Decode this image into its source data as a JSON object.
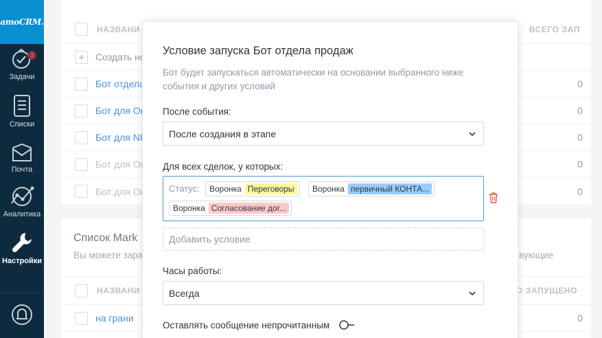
{
  "sidebar": {
    "logo": "amoCRM.",
    "badge": "3",
    "items": [
      {
        "label": "Задачи",
        "icon": "tasks-icon"
      },
      {
        "label": "Списки",
        "icon": "lists-icon"
      },
      {
        "label": "Почта",
        "icon": "mail-icon"
      },
      {
        "label": "Аналитика",
        "icon": "analytics-icon"
      },
      {
        "label": "Настройки",
        "icon": "settings-icon",
        "active": true
      }
    ],
    "bottom_icon": "bell-icon"
  },
  "background": {
    "top_table": {
      "header": "НАЗВАНИ",
      "header_right": "ВСЕГО ЗАП",
      "create_label": "Создать но",
      "rows": [
        {
          "name": "Бот отдела",
          "value": "0",
          "style": "link"
        },
        {
          "name": "Бот для Он",
          "value": "0",
          "style": "link"
        },
        {
          "name": "Бот для NP",
          "value": "0",
          "style": "link"
        },
        {
          "name": "Бот для Он",
          "value": "0",
          "style": "muted"
        },
        {
          "name": "Бот для Он",
          "value": "0",
          "style": "muted"
        }
      ]
    },
    "bottom_section": {
      "title": "Список Mark",
      "subtitle": "Вы можете зара",
      "subtitle_right": "вующие",
      "header": "НАЗВАНИ",
      "header_right": "О ЗАПУЩЕНО",
      "rows": [
        {
          "name": "на грани",
          "value": "0"
        }
      ]
    }
  },
  "modal": {
    "title": "Условие запуска Бот отдела продаж",
    "subtitle": "Бот будет запускаться автоматически на основании выбранного ниже события и других условий",
    "event_label": "После события:",
    "event_value": "После создания в этапе",
    "deals_label": "Для всех сделок, у которых:",
    "status_label": "Статус:",
    "tags": [
      {
        "pipeline": "Воронка",
        "stage": "Переговоры",
        "color": "#fbf59a"
      },
      {
        "pipeline": "Воронка",
        "stage": "первичный КОНТА...",
        "color": "#99ccff"
      },
      {
        "pipeline": "Воронка",
        "stage": "Согласование дог...",
        "color": "#ffc8c8"
      }
    ],
    "add_condition": "Добавить условие",
    "hours_label": "Часы работы:",
    "hours_value": "Всегда",
    "unread_label": "Оставлять сообщение непрочитанным"
  },
  "colors": {
    "sidebar": "#0e2a3f",
    "logo_bg": "#0a8fd1",
    "accent": "#4c9bc7",
    "link": "#4a90d9",
    "trash": "#e05a4f"
  }
}
